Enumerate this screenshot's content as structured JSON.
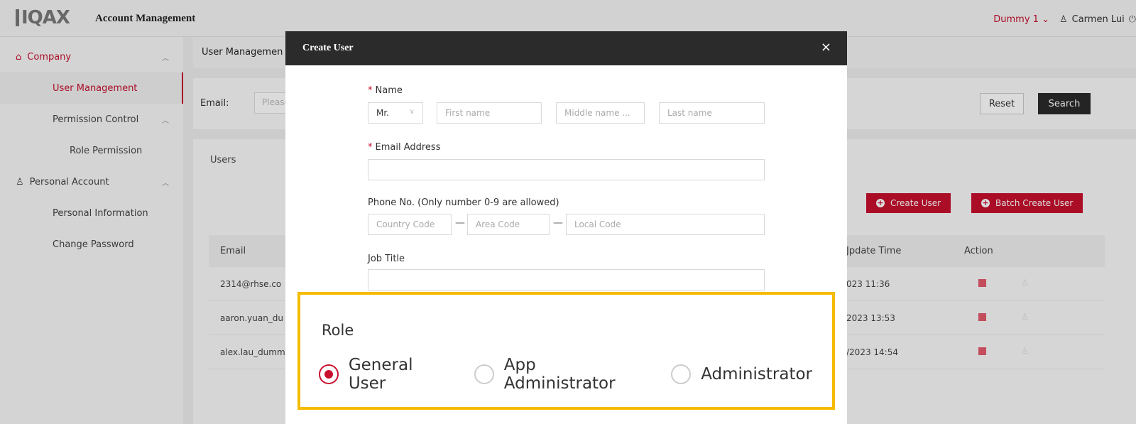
{
  "header": {
    "logo_text": "IQAX",
    "app_title": "Account Management",
    "tenant": "Dummy 1",
    "user_name": "Carmen Lui"
  },
  "sidebar": {
    "items": [
      {
        "label": "Company"
      },
      {
        "label": "User Management"
      },
      {
        "label": "Permission Control"
      },
      {
        "label": "Role Permission"
      },
      {
        "label": "Personal Account"
      },
      {
        "label": "Personal Information"
      },
      {
        "label": "Change Password"
      }
    ]
  },
  "main": {
    "tab_label": "User Managemen",
    "filter": {
      "email_label": "Email:",
      "email_placeholder": "Please",
      "reset_label": "Reset",
      "search_label": "Search"
    },
    "users": {
      "title": "Users",
      "create_label": "Create User",
      "batch_label": "Batch Create User",
      "columns": {
        "email": "Email",
        "update_time": "Jpdate Time",
        "action": "Action"
      },
      "rows": [
        {
          "email": "2314@rhse.co",
          "update_time": "023 11:36"
        },
        {
          "email": "aaron.yuan_du",
          "update_time": "2023 13:53"
        },
        {
          "email": "alex.lau_dumm",
          "update_time": "/2023 14:54"
        }
      ]
    }
  },
  "modal": {
    "title": "Create User",
    "close": "×",
    "name": {
      "label": "Name",
      "title_value": "Mr.",
      "first_placeholder": "First name",
      "middle_placeholder": "Middle name ...",
      "last_placeholder": "Last name"
    },
    "email": {
      "label": "Email Address"
    },
    "phone": {
      "label": "Phone No. (Only number 0-9 are allowed)",
      "country_placeholder": "Country Code",
      "area_placeholder": "Area Code",
      "local_placeholder": "Local Code"
    },
    "job": {
      "label": "Job Title"
    },
    "role": {
      "label": "Role",
      "options": [
        {
          "label": "General User",
          "selected": true
        },
        {
          "label": "App Administrator",
          "selected": false
        },
        {
          "label": "Administrator",
          "selected": false
        }
      ]
    }
  },
  "colors": {
    "accent": "#c8102e",
    "highlight": "#f5bb00",
    "dark": "#2b2b2b"
  }
}
